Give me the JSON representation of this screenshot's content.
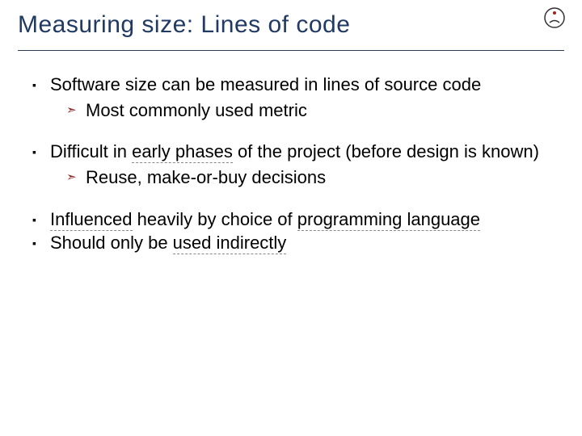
{
  "title": "Measuring size: Lines of code",
  "bullets": {
    "b1": {
      "text": "Software size can be measured in lines of source code",
      "sub": {
        "text": "Most commonly used metric"
      }
    },
    "b2": {
      "plain1": "Difficult in ",
      "u1": "early phases",
      "plain2": " of the project (before design is known)",
      "sub": {
        "text": "Reuse, make-or-buy decisions"
      }
    },
    "b3": {
      "plain1": "Influenced",
      "plain2": " heavily by choice of ",
      "u1": "programming language"
    },
    "b4": {
      "plain1": "Should only be ",
      "u1": "used indirectly"
    }
  }
}
